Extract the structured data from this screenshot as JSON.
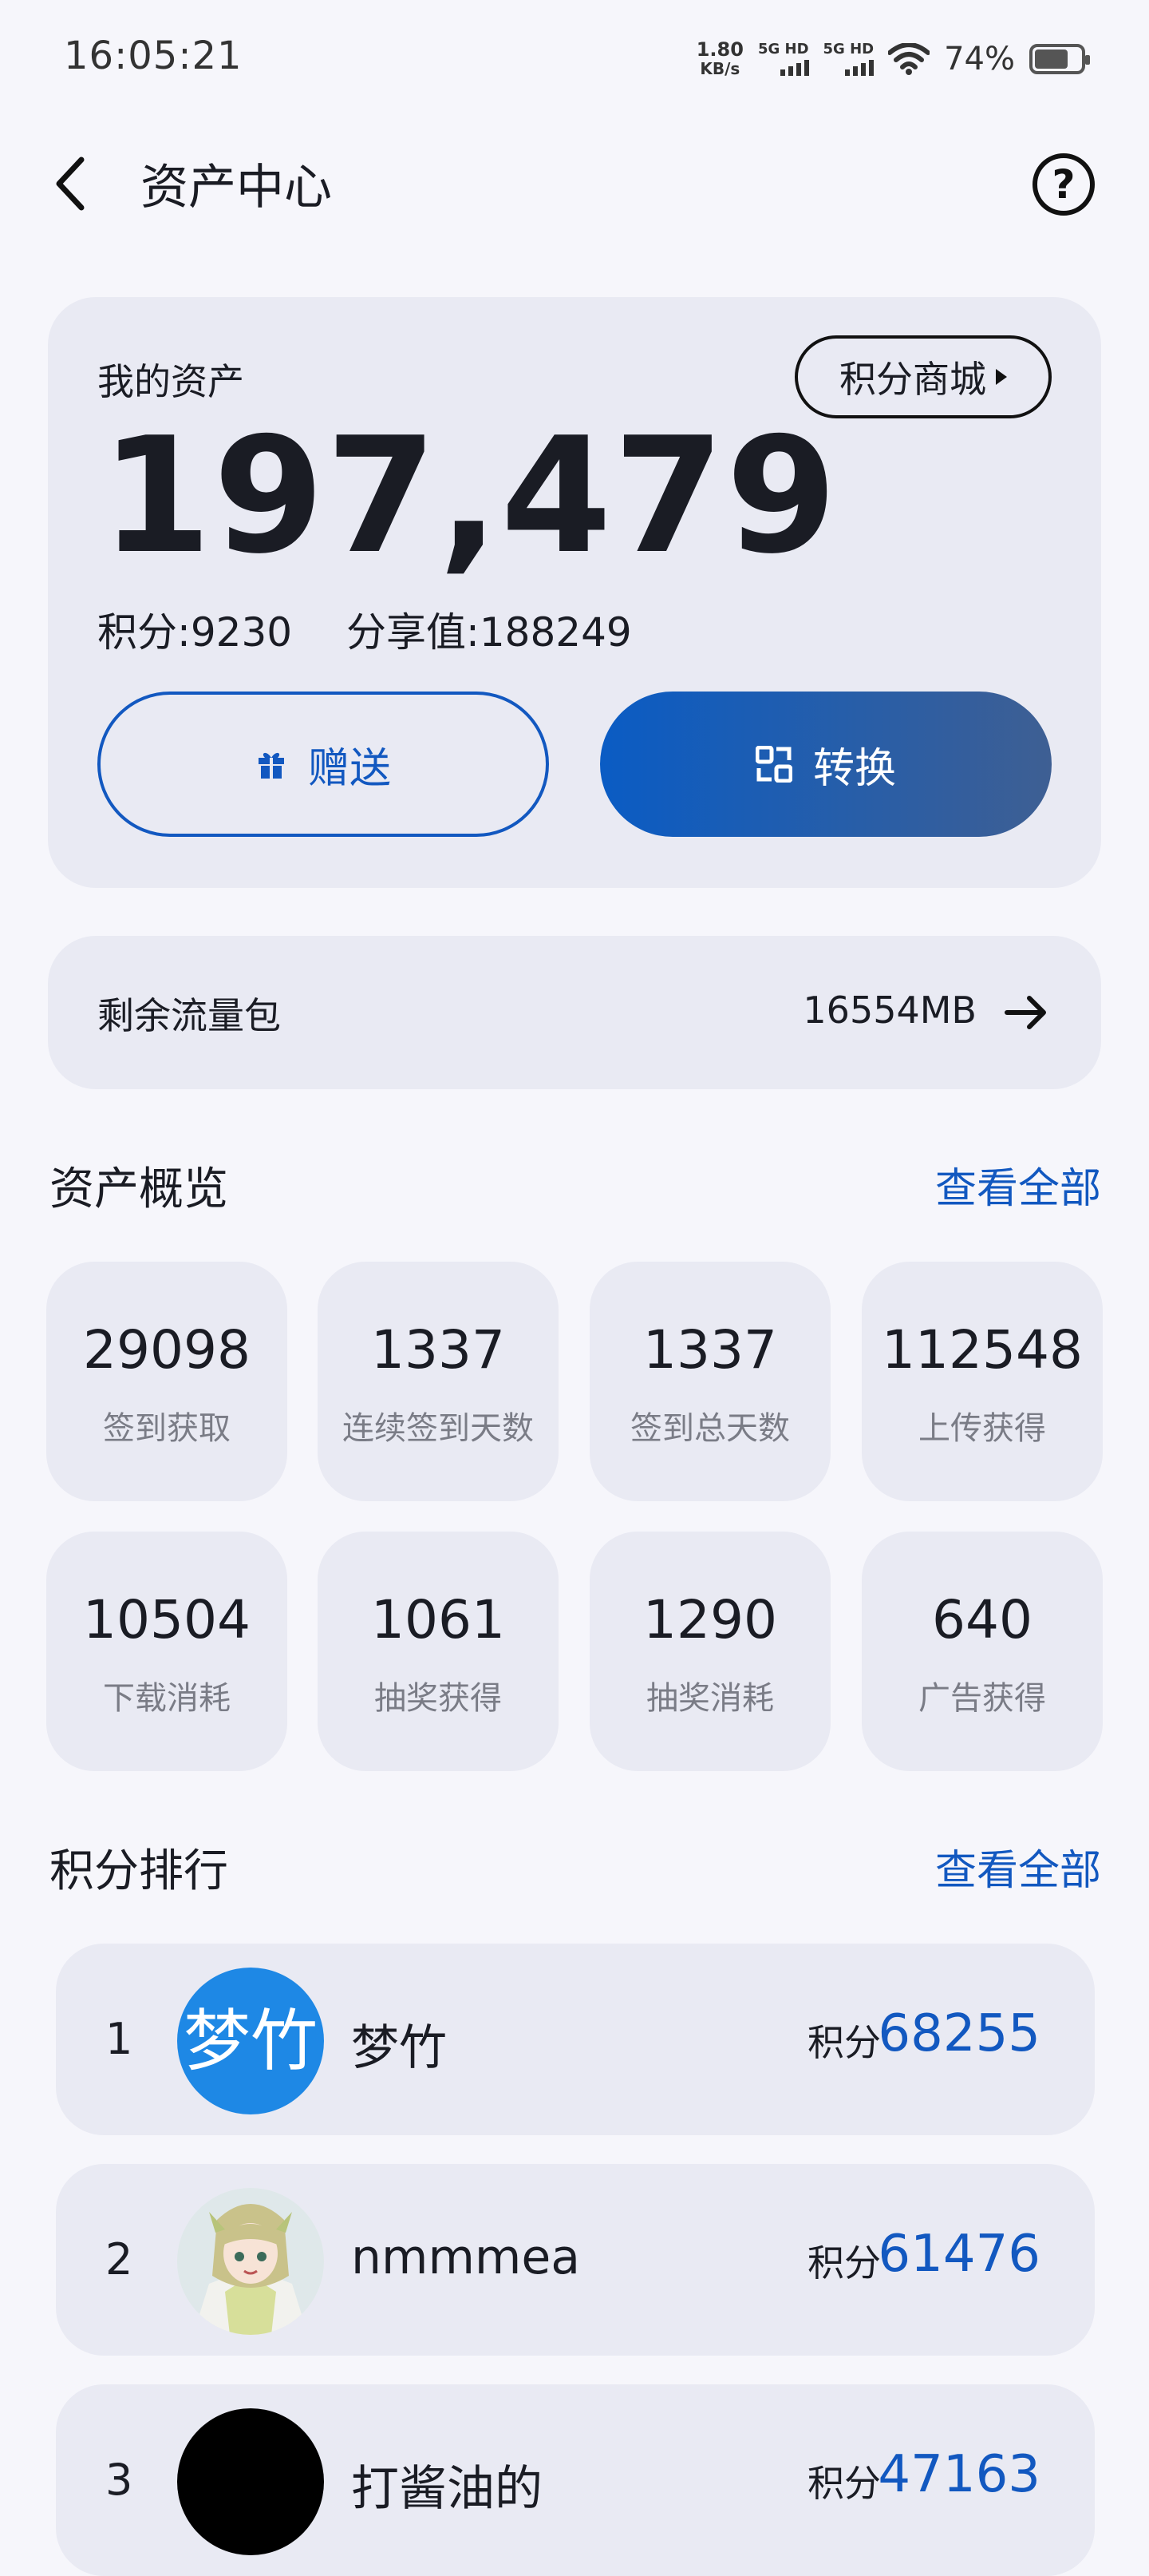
{
  "status_bar": {
    "time": "16:05:21",
    "net_speed_value": "1.80",
    "net_speed_unit": "KB/s",
    "sim1": "5G HD",
    "sim2": "5G HD",
    "battery_pct": "74%",
    "battery_level": 0.74
  },
  "header": {
    "title": "资产中心",
    "back_icon": "chevron-left-icon",
    "help_icon": "question-circle-icon"
  },
  "assets": {
    "label": "我的资产",
    "shop_button": "积分商城",
    "total": "197,479",
    "points": "积分:9230",
    "share": "分享值:188249",
    "gift_button": "赠送",
    "convert_button": "转换"
  },
  "data_pack": {
    "label": "剩余流量包",
    "value": "16554MB"
  },
  "overview": {
    "title": "资产概览",
    "see_all": "查看全部",
    "stats": [
      {
        "value": "29098",
        "label": "签到获取"
      },
      {
        "value": "1337",
        "label": "连续签到天数"
      },
      {
        "value": "1337",
        "label": "签到总天数"
      },
      {
        "value": "112548",
        "label": "上传获得"
      },
      {
        "value": "10504",
        "label": "下载消耗"
      },
      {
        "value": "1061",
        "label": "抽奖获得"
      },
      {
        "value": "1290",
        "label": "抽奖消耗"
      },
      {
        "value": "640",
        "label": "广告获得"
      }
    ]
  },
  "ranking": {
    "title": "积分排行",
    "see_all": "查看全部",
    "points_label": "积分",
    "rows": [
      {
        "rank": "1",
        "avatar_text": "梦竹",
        "name": "梦竹",
        "points": "68255"
      },
      {
        "rank": "2",
        "avatar_text": "",
        "name": "nmmmea",
        "points": "61476"
      },
      {
        "rank": "3",
        "avatar_text": "",
        "name": "打酱油的",
        "points": "47163"
      }
    ]
  },
  "colors": {
    "accent": "#1258c0",
    "card": "#e9eaf3",
    "bg": "#f6f6fb"
  }
}
